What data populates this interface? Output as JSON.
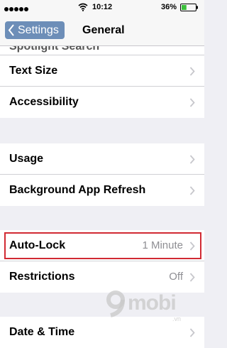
{
  "status_bar": {
    "time": "10:12",
    "battery_percent": "36%",
    "battery_level": 0.36
  },
  "nav": {
    "back_label": "Settings",
    "title": "General"
  },
  "group1": {
    "partial_label": "Spotlight Search",
    "items": [
      {
        "label": "Text Size"
      },
      {
        "label": "Accessibility"
      }
    ]
  },
  "group2": {
    "items": [
      {
        "label": "Usage"
      },
      {
        "label": "Background App Refresh"
      }
    ]
  },
  "group3": {
    "items": [
      {
        "label": "Auto-Lock",
        "value": "1 Minute"
      },
      {
        "label": "Restrictions",
        "value": "Off"
      }
    ]
  },
  "group4": {
    "items": [
      {
        "label": "Date & Time"
      }
    ]
  },
  "watermark": {
    "text": "mobi",
    "sub": ".vn"
  },
  "colors": {
    "back_button": "#6d8eb8",
    "highlight_border": "#d12a33",
    "background": "#efeff4"
  }
}
